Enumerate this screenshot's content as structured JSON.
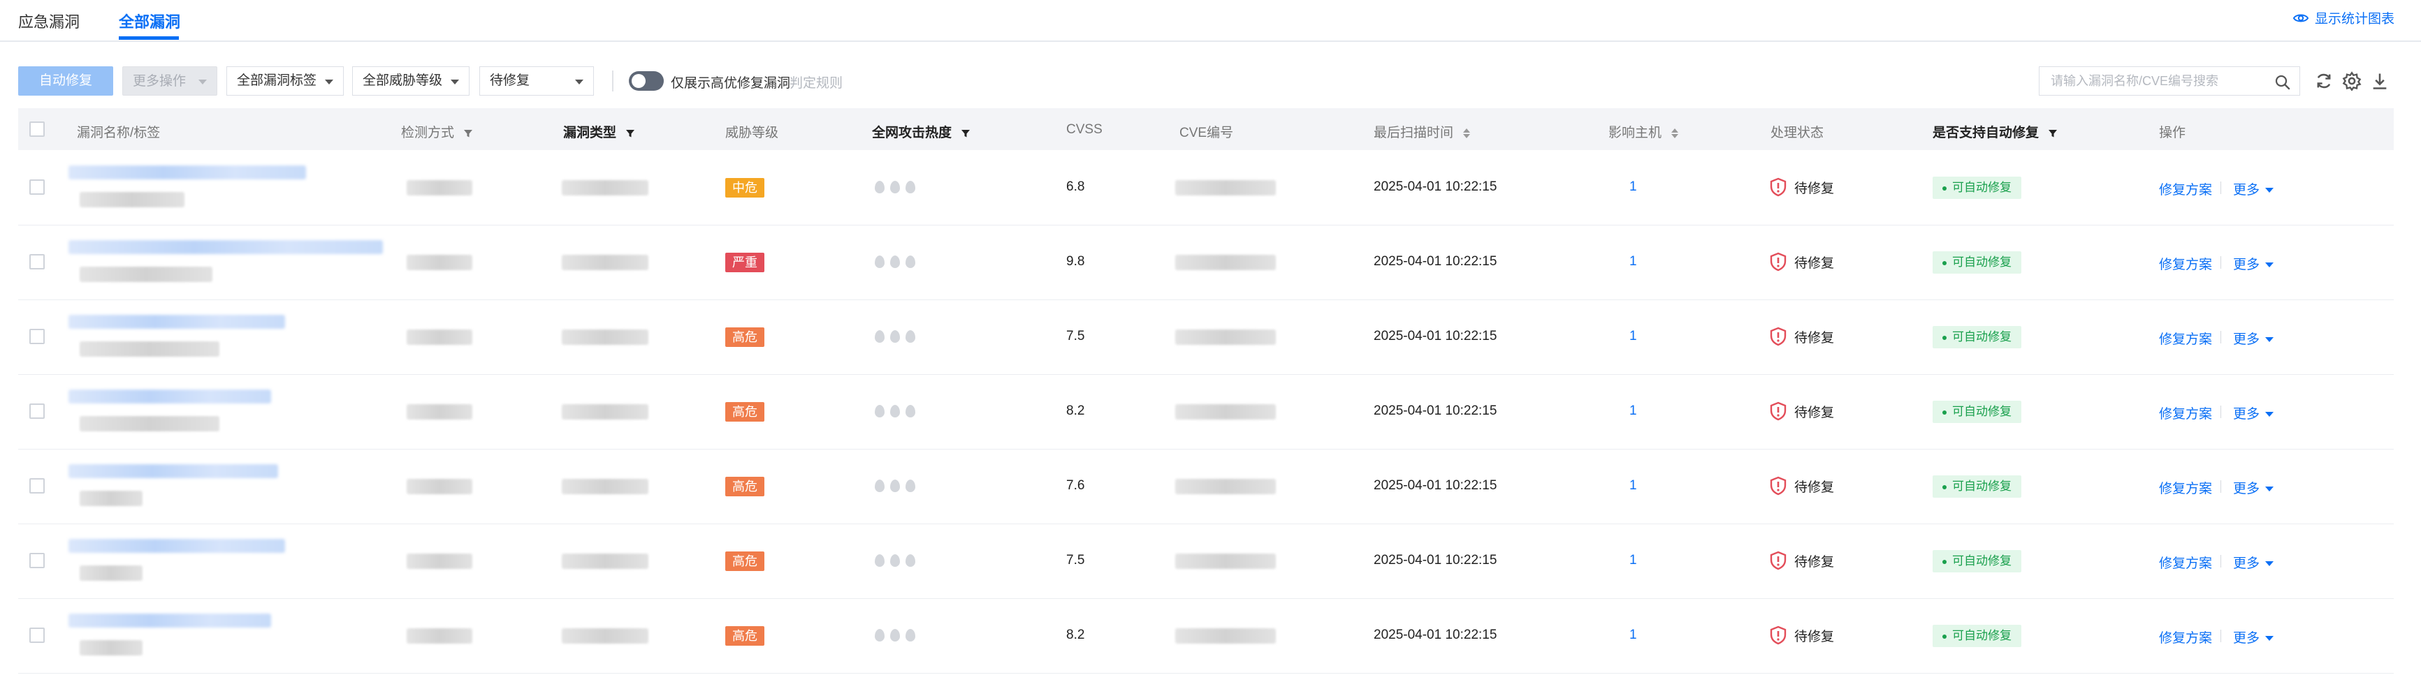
{
  "tabs": [
    {
      "label": "应急漏洞",
      "active": false
    },
    {
      "label": "全部漏洞",
      "active": true
    }
  ],
  "stats_link": {
    "label": "显示统计图表",
    "icon": "eye-icon"
  },
  "toolbar": {
    "auto_fix_label": "自动修复",
    "more_ops_label": "更多操作",
    "tag_select": "全部漏洞标签",
    "level_select": "全部威胁等级",
    "status_select": "待修复",
    "toggle_label": "仅展示高优修复漏洞",
    "rule_link": "判定规则",
    "search_placeholder": "请输入漏洞名称/CVE编号搜索",
    "icons": [
      "search-icon",
      "refresh-icon",
      "settings-icon",
      "download-icon"
    ]
  },
  "columns": {
    "name": "漏洞名称/标签",
    "detect": "检测方式",
    "type": "漏洞类型",
    "level": "威胁等级",
    "heat": "全网攻击热度",
    "cvss": "CVSS",
    "cve": "CVE编号",
    "scan_time": "最后扫描时间",
    "hosts": "影响主机",
    "status": "处理状态",
    "auto": "是否支持自动修复",
    "ops": "操作"
  },
  "colors": {
    "accent": "#0a6ff5",
    "level_medium": "#f5a623",
    "level_critical": "#e34d59",
    "level_high": "#f07c4a",
    "auto_fix_green": "#1aa04d",
    "status_red": "#e34d59"
  },
  "rows": [
    {
      "level": "中危",
      "level_color": "#f5a623",
      "cvss": "6.8",
      "scan_time": "2025-04-01 10:22:15",
      "hosts": "1",
      "status": "待修复",
      "auto": "可自动修复",
      "fix": "修复方案",
      "more": "更多"
    },
    {
      "level": "严重",
      "level_color": "#e34d59",
      "cvss": "9.8",
      "scan_time": "2025-04-01 10:22:15",
      "hosts": "1",
      "status": "待修复",
      "auto": "可自动修复",
      "fix": "修复方案",
      "more": "更多"
    },
    {
      "level": "高危",
      "level_color": "#f07c4a",
      "cvss": "7.5",
      "scan_time": "2025-04-01 10:22:15",
      "hosts": "1",
      "status": "待修复",
      "auto": "可自动修复",
      "fix": "修复方案",
      "more": "更多"
    },
    {
      "level": "高危",
      "level_color": "#f07c4a",
      "cvss": "8.2",
      "scan_time": "2025-04-01 10:22:15",
      "hosts": "1",
      "status": "待修复",
      "auto": "可自动修复",
      "fix": "修复方案",
      "more": "更多"
    },
    {
      "level": "高危",
      "level_color": "#f07c4a",
      "cvss": "7.6",
      "scan_time": "2025-04-01 10:22:15",
      "hosts": "1",
      "status": "待修复",
      "auto": "可自动修复",
      "fix": "修复方案",
      "more": "更多"
    },
    {
      "level": "高危",
      "level_color": "#f07c4a",
      "cvss": "7.5",
      "scan_time": "2025-04-01 10:22:15",
      "hosts": "1",
      "status": "待修复",
      "auto": "可自动修复",
      "fix": "修复方案",
      "more": "更多"
    },
    {
      "level": "高危",
      "level_color": "#f07c4a",
      "cvss": "8.2",
      "scan_time": "2025-04-01 10:22:15",
      "hosts": "1",
      "status": "待修复",
      "auto": "可自动修复",
      "fix": "修复方案",
      "more": "更多"
    }
  ]
}
